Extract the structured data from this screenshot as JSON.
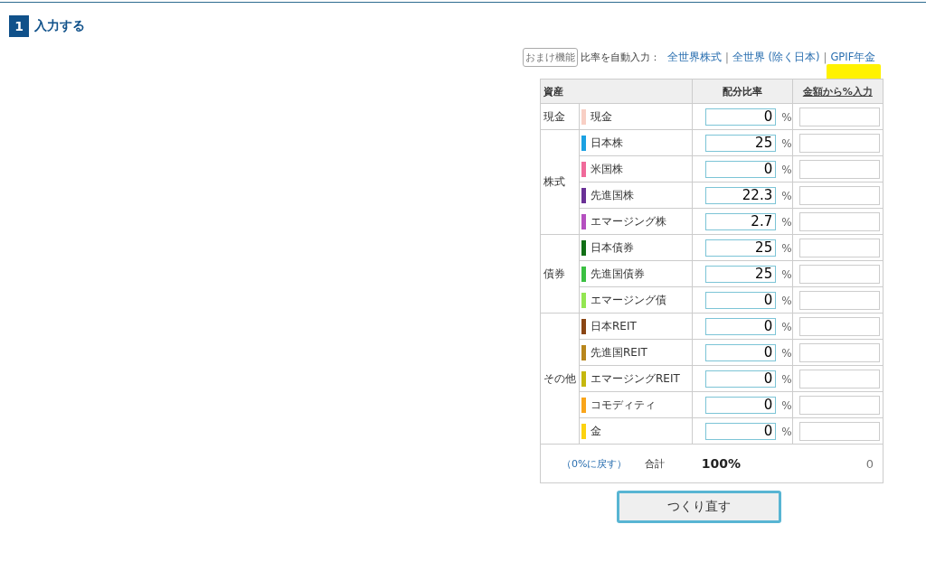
{
  "section": {
    "number": "1",
    "title": "入力する"
  },
  "toolbar": {
    "badge": "おまけ機能",
    "label": "比率を自動入力：",
    "presets": [
      "全世界株式",
      "全世界 (除く日本)",
      "GPIF年金"
    ],
    "separator": "|"
  },
  "table": {
    "columns": [
      "資産",
      "配分比率",
      "金額から%入力"
    ],
    "groups": [
      {
        "name": "現金",
        "assets": [
          {
            "name": "現金",
            "color": "#f8cfc4",
            "ratio": "0",
            "unit": "%"
          }
        ]
      },
      {
        "name": "株式",
        "assets": [
          {
            "name": "日本株",
            "color": "#1ba1e2",
            "ratio": "25",
            "unit": "%"
          },
          {
            "name": "米国株",
            "color": "#f06a9a",
            "ratio": "0",
            "unit": "%"
          },
          {
            "name": "先進国株",
            "color": "#6a3196",
            "ratio": "22.3",
            "unit": "%"
          },
          {
            "name": "エマージング株",
            "color": "#b54fc0",
            "ratio": "2.7",
            "unit": "%"
          }
        ]
      },
      {
        "name": "債券",
        "assets": [
          {
            "name": "日本債券",
            "color": "#116f16",
            "ratio": "25",
            "unit": "%"
          },
          {
            "name": "先進国債券",
            "color": "#3bc042",
            "ratio": "25",
            "unit": "%"
          },
          {
            "name": "エマージング債",
            "color": "#93e651",
            "ratio": "0",
            "unit": "%"
          }
        ]
      },
      {
        "name": "その他",
        "assets": [
          {
            "name": "日本REIT",
            "color": "#8a4614",
            "ratio": "0",
            "unit": "%"
          },
          {
            "name": "先進国REIT",
            "color": "#b8861c",
            "ratio": "0",
            "unit": "%"
          },
          {
            "name": "エマージングREIT",
            "color": "#c5b70e",
            "ratio": "0",
            "unit": "%"
          },
          {
            "name": "コモディティ",
            "color": "#f9a51a",
            "ratio": "0",
            "unit": "%"
          },
          {
            "name": "金",
            "color": "#fcd20f",
            "ratio": "0",
            "unit": "%"
          }
        ]
      }
    ],
    "footer": {
      "reset": "（0%に戻す）",
      "total_label": "合計",
      "total": "100%",
      "amount_total": "0"
    }
  },
  "submit": "つくり直す"
}
